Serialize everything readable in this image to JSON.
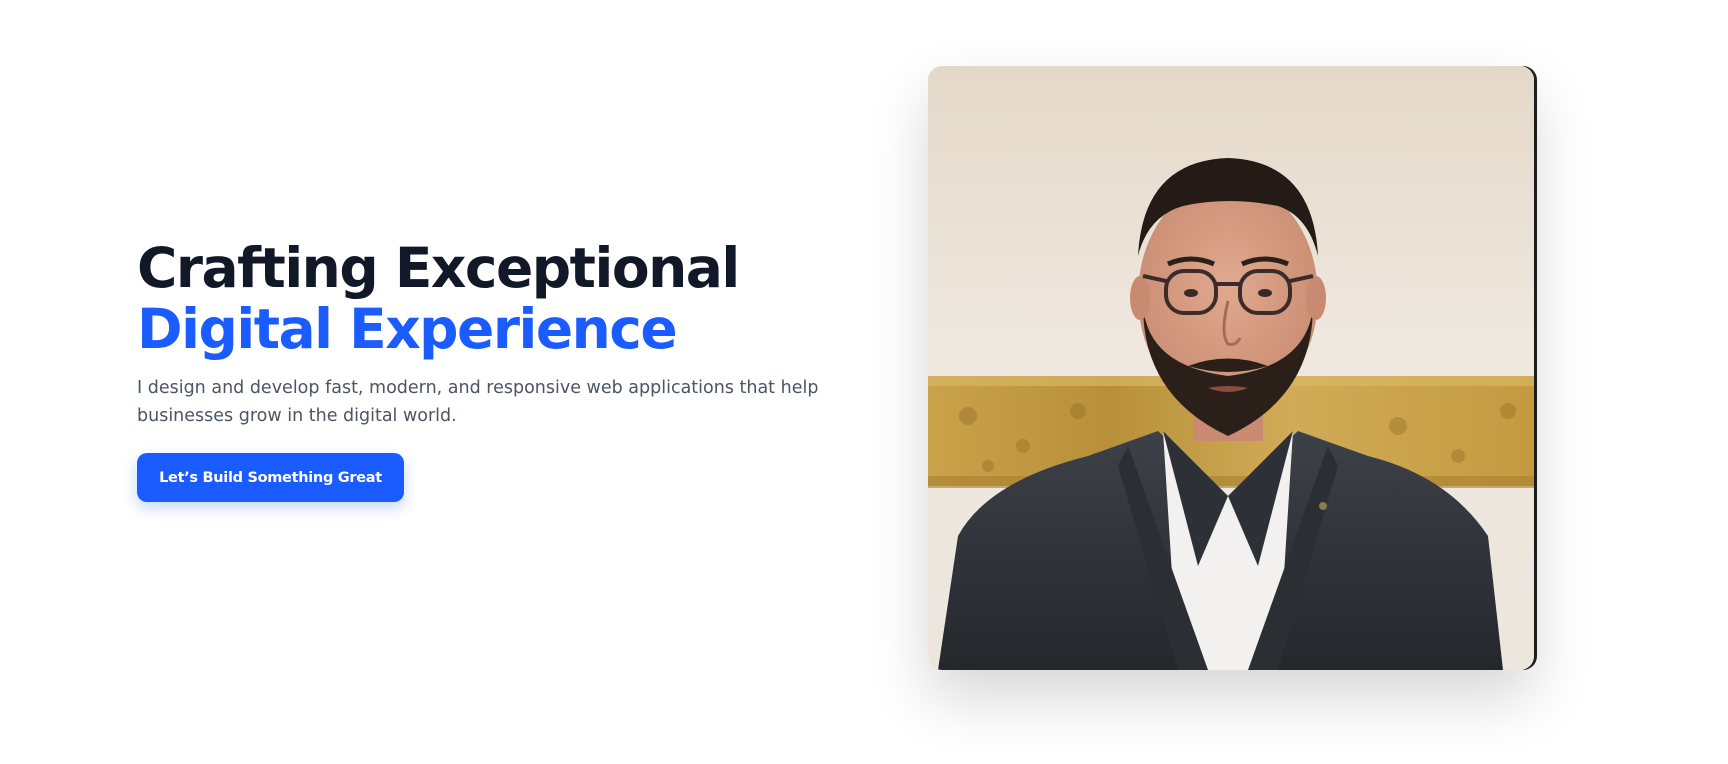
{
  "hero": {
    "headline_line1": "Crafting Exceptional",
    "headline_line2": "Digital Experience",
    "subtext": "I design and develop fast, modern, and responsive web applications that help businesses grow in the digital world.",
    "cta_label": "Let’s Build Something Great"
  },
  "portrait": {
    "alt": "portrait-photo"
  },
  "colors": {
    "accent": "#1a5cff",
    "heading": "#111827",
    "body_text": "#4b5563",
    "background": "#ffffff"
  }
}
